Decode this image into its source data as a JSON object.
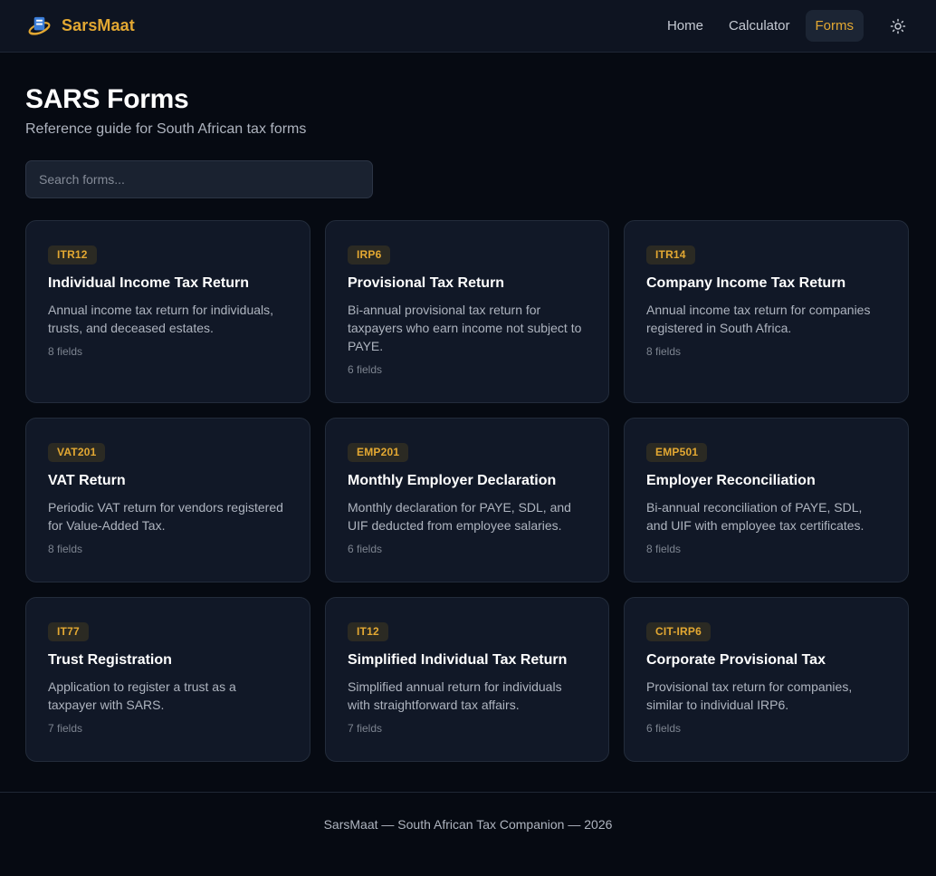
{
  "brand": {
    "name": "SarsMaat"
  },
  "nav": {
    "items": [
      {
        "label": "Home"
      },
      {
        "label": "Calculator"
      },
      {
        "label": "Forms"
      }
    ],
    "active": "Forms",
    "theme_icon": "sun-icon"
  },
  "page": {
    "title": "SARS Forms",
    "subtitle": "Reference guide for South African tax forms"
  },
  "search": {
    "placeholder": "Search forms...",
    "value": ""
  },
  "forms": [
    {
      "code": "ITR12",
      "title": "Individual Income Tax Return",
      "description": "Annual income tax return for individuals, trusts, and deceased estates.",
      "fields": "8 fields"
    },
    {
      "code": "IRP6",
      "title": "Provisional Tax Return",
      "description": "Bi-annual provisional tax return for taxpayers who earn income not subject to PAYE.",
      "fields": "6 fields"
    },
    {
      "code": "ITR14",
      "title": "Company Income Tax Return",
      "description": "Annual income tax return for companies registered in South Africa.",
      "fields": "8 fields"
    },
    {
      "code": "VAT201",
      "title": "VAT Return",
      "description": "Periodic VAT return for vendors registered for Value-Added Tax.",
      "fields": "8 fields"
    },
    {
      "code": "EMP201",
      "title": "Monthly Employer Declaration",
      "description": "Monthly declaration for PAYE, SDL, and UIF deducted from employee salaries.",
      "fields": "6 fields"
    },
    {
      "code": "EMP501",
      "title": "Employer Reconciliation",
      "description": "Bi-annual reconciliation of PAYE, SDL, and UIF with employee tax certificates.",
      "fields": "8 fields"
    },
    {
      "code": "IT77",
      "title": "Trust Registration",
      "description": "Application to register a trust as a taxpayer with SARS.",
      "fields": "7 fields"
    },
    {
      "code": "IT12",
      "title": "Simplified Individual Tax Return",
      "description": "Simplified annual return for individuals with straightforward tax affairs.",
      "fields": "7 fields"
    },
    {
      "code": "CIT-IRP6",
      "title": "Corporate Provisional Tax",
      "description": "Provisional tax return for companies, similar to individual IRP6.",
      "fields": "6 fields"
    }
  ],
  "footer": {
    "text": "SarsMaat — South African Tax Companion — 2026"
  },
  "colors": {
    "accent": "#e3a832",
    "background": "#060a12",
    "card": "#111827",
    "navbar": "#0e1421"
  }
}
